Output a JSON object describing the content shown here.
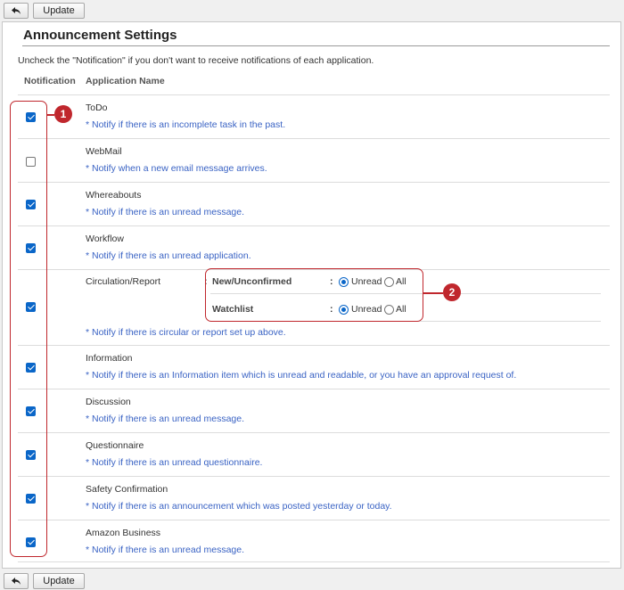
{
  "toolbar": {
    "back_icon": "back-arrow-icon",
    "update_label": "Update"
  },
  "page": {
    "title": "Announcement Settings",
    "description": "Uncheck the \"Notification\" if you don't want to receive notifications of each application.",
    "col_notification": "Notification",
    "col_app_name": "Application Name"
  },
  "apps": [
    {
      "name": "ToDo",
      "note": "* Notify if there is an incomplete task in the past.",
      "checked": true
    },
    {
      "name": "WebMail",
      "note": "* Notify when a new email message arrives.",
      "checked": false
    },
    {
      "name": "Whereabouts",
      "note": "* Notify if there is an unread message.",
      "checked": true
    },
    {
      "name": "Workflow",
      "note": "* Notify if there is an unread application.",
      "checked": true
    },
    {
      "name": "Circulation/Report",
      "note": "* Notify if there is circular or report set up above.",
      "checked": true
    },
    {
      "name": "Information",
      "note": "* Notify if there is an Information item which is unread and readable, or you have an approval request of.",
      "checked": true
    },
    {
      "name": "Discussion",
      "note": "* Notify if there is an unread message.",
      "checked": true
    },
    {
      "name": "Questionnaire",
      "note": "* Notify if there is an unread questionnaire.",
      "checked": true
    },
    {
      "name": "Safety Confirmation",
      "note": "* Notify if there is an announcement which was posted yesterday or today.",
      "checked": true
    },
    {
      "name": "Amazon Business",
      "note": "* Notify if there is an unread message.",
      "checked": true
    }
  ],
  "circulation": {
    "colon": ":",
    "options": [
      {
        "label": "New/Unconfirmed",
        "unread": "Unread",
        "all": "All",
        "selected": "Unread"
      },
      {
        "label": "Watchlist",
        "unread": "Unread",
        "all": "All",
        "selected": "Unread"
      }
    ]
  },
  "callouts": [
    "1",
    "2"
  ],
  "colors": {
    "accent": "#0a66c8",
    "callout": "#c0272d",
    "note": "#3a63c4"
  }
}
